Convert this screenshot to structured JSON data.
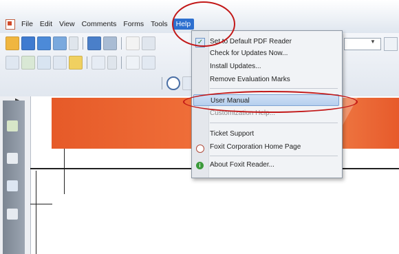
{
  "menubar": {
    "items": [
      {
        "label": "File"
      },
      {
        "label": "Edit"
      },
      {
        "label": "View"
      },
      {
        "label": "Comments"
      },
      {
        "label": "Forms"
      },
      {
        "label": "Tools"
      },
      {
        "label": "Help"
      }
    ]
  },
  "help_menu": {
    "items": [
      {
        "label": "Set to Default PDF Reader",
        "icon": "check-icon"
      },
      {
        "label": "Check for Updates Now..."
      },
      {
        "label": "Install Updates..."
      },
      {
        "label": "Remove Evaluation Marks"
      },
      {
        "label": "User Manual",
        "highlighted": true
      },
      {
        "label": "Customization Help..."
      },
      {
        "label": "Ticket Support"
      },
      {
        "label": "Foxit Corporation Home Page",
        "icon": "globe-icon"
      },
      {
        "label": "About Foxit Reader...",
        "icon": "info-icon"
      }
    ]
  },
  "colors": {
    "accent": "#2c6fcf",
    "annotation": "#c21818",
    "header_orange": "#e65a28"
  }
}
